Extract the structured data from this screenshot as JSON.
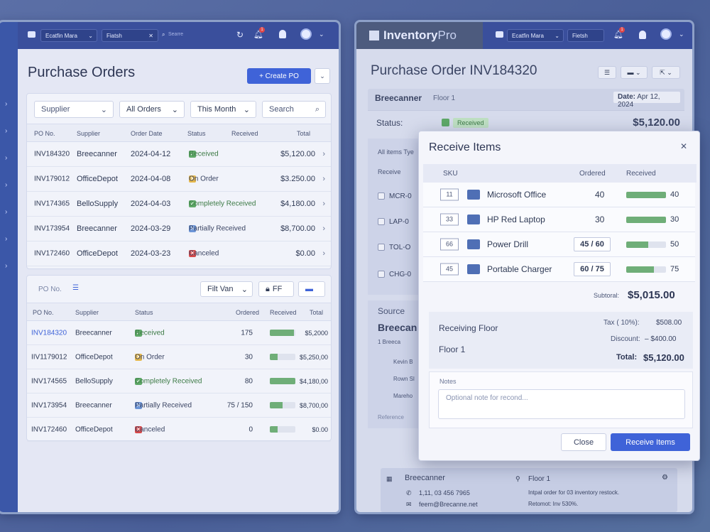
{
  "left": {
    "topbar": {
      "user": "Ecatfin Mara",
      "fetch": "Fiatsh",
      "search_placeholder": "Searre",
      "notif_count": "1"
    },
    "title": "Purchase Orders",
    "create_label": "+  Create PO",
    "filters": {
      "supplier": "Supplier",
      "orders": "All Orders",
      "period": "This Month",
      "search": "Search"
    },
    "table1": {
      "headers": [
        "PO No.",
        "Supplier",
        "Order Date",
        "Status",
        "Received",
        "Total"
      ],
      "rows": [
        {
          "po": "INV184320",
          "supplier": "Breecanner",
          "date": "2024-04-12",
          "status": "Received",
          "total": "$5,120.00"
        },
        {
          "po": "INV179012",
          "supplier": "OfficeDepot",
          "date": "2024-04-08",
          "status": "On Order",
          "total": "$3.250.00"
        },
        {
          "po": "INV174365",
          "supplier": "BelloSupply",
          "date": "2024-04-03",
          "status": "Completely Received",
          "total": "$4,180.00"
        },
        {
          "po": "INV173954",
          "supplier": "Breecanner",
          "date": "2024-03-29",
          "status": "Partially Received",
          "total": "$8,700.00"
        },
        {
          "po": "INV172460",
          "supplier": "OfficeDepot",
          "date": "2024-03-23",
          "status": "Canceled",
          "total": "$0.00"
        }
      ]
    },
    "panel2": {
      "po_label": "PO No.",
      "filter": "Filt Van",
      "ff": "FF",
      "headers": [
        "PO No.",
        "Supplier",
        "Status",
        "Ordered",
        "Received",
        "Total"
      ],
      "rows": [
        {
          "po": "INV184320",
          "supplier": "Breecanner",
          "status": "Received",
          "ordered": "175",
          "received_frac": 0.95,
          "total": "$5,2000"
        },
        {
          "po": "IIV1179012",
          "supplier": "OfficeDepot",
          "status": "On Order",
          "ordered": "30",
          "received_frac": 0.3,
          "total": "$5,250,00"
        },
        {
          "po": "INV174565",
          "supplier": "BelloSupply",
          "status": "Completely Received",
          "ordered": "80",
          "received_frac": 1.0,
          "total": "$4,180,00"
        },
        {
          "po": "INV173954",
          "supplier": "Breecanner",
          "status": "Partially Received",
          "ordered": "75 / 150",
          "received_frac": 0.5,
          "total": "$8,700,00"
        },
        {
          "po": "INV172460",
          "supplier": "OfficeDepot",
          "status": "Canceled",
          "ordered": "0",
          "received_frac": 0.3,
          "total": "$0.00"
        }
      ]
    }
  },
  "right": {
    "brand": {
      "a": "Inventory",
      "b": "Pro"
    },
    "topbar": {
      "user": "Ecatfin Mara",
      "fetch": "Fietsh",
      "notif_count": "1"
    },
    "title": "Purchase Order INV184320",
    "supplier": "Breecanner",
    "floor": "Floor 1",
    "date_label": "Date:",
    "date": "Apr 12, 2024",
    "status_label": "Status:",
    "status": "Received",
    "amount": "$5,120.00",
    "bg_items_label": "All items Tye",
    "bg_receive": "Receive",
    "bg_skus": [
      "MCR-0",
      "LAP-0",
      "TOL-O",
      "CHG-0"
    ],
    "source_label": "Source",
    "source_name": "Breecan",
    "source_sub": "1 Breeca",
    "source_lines": [
      "Kevin B",
      "Rown Sl",
      "Mareho"
    ],
    "reference": "Reference",
    "footer": {
      "name": "Breecanner",
      "phone": "1,11, 03 456 7965",
      "email": "feem@Brecanne.net",
      "floor": "Floor 1",
      "note1": "Intpal order for 03 inventory restock.",
      "note2": "Retomot: Inv 530%."
    }
  },
  "modal": {
    "title": "Receive Items",
    "headers": {
      "sku": "SKU",
      "ordered": "Ordered",
      "received": "Received"
    },
    "items": [
      {
        "sku": "11",
        "name": "Microsoft Office",
        "ordered": "40",
        "received": "40",
        "frac": 1.0
      },
      {
        "sku": "33",
        "name": "HP Red Laptop",
        "ordered": "30",
        "received": "30",
        "frac": 1.0
      },
      {
        "sku": "66",
        "name": "Power Drill",
        "ordered": "45 / 60",
        "received": "50",
        "frac": 0.55
      },
      {
        "sku": "45",
        "name": "Portable Charger",
        "ordered": "60 / 75",
        "received": "75",
        "frac": 0.7
      }
    ],
    "subtotal_label": "Subtoral:",
    "subtotal": "$5,015.00",
    "receiving_floor_label": "Receiving Floor",
    "floor": "Floor 1",
    "tax_label": "Tax ( 10%):",
    "tax": "$508.00",
    "discount_label": "Discount:",
    "discount": "–  $400.00",
    "total_label": "Total:",
    "total": "$5,120.00",
    "notes_label": "Notes",
    "notes_placeholder": "Optional note for recond...",
    "close": "Close",
    "receive": "Receive Items"
  },
  "colors": {
    "accent": "#3f63d8",
    "received": "#5fa968",
    "onorder": "#e6b84a",
    "partial": "#6d96d8",
    "canceled": "#d84a4a"
  }
}
